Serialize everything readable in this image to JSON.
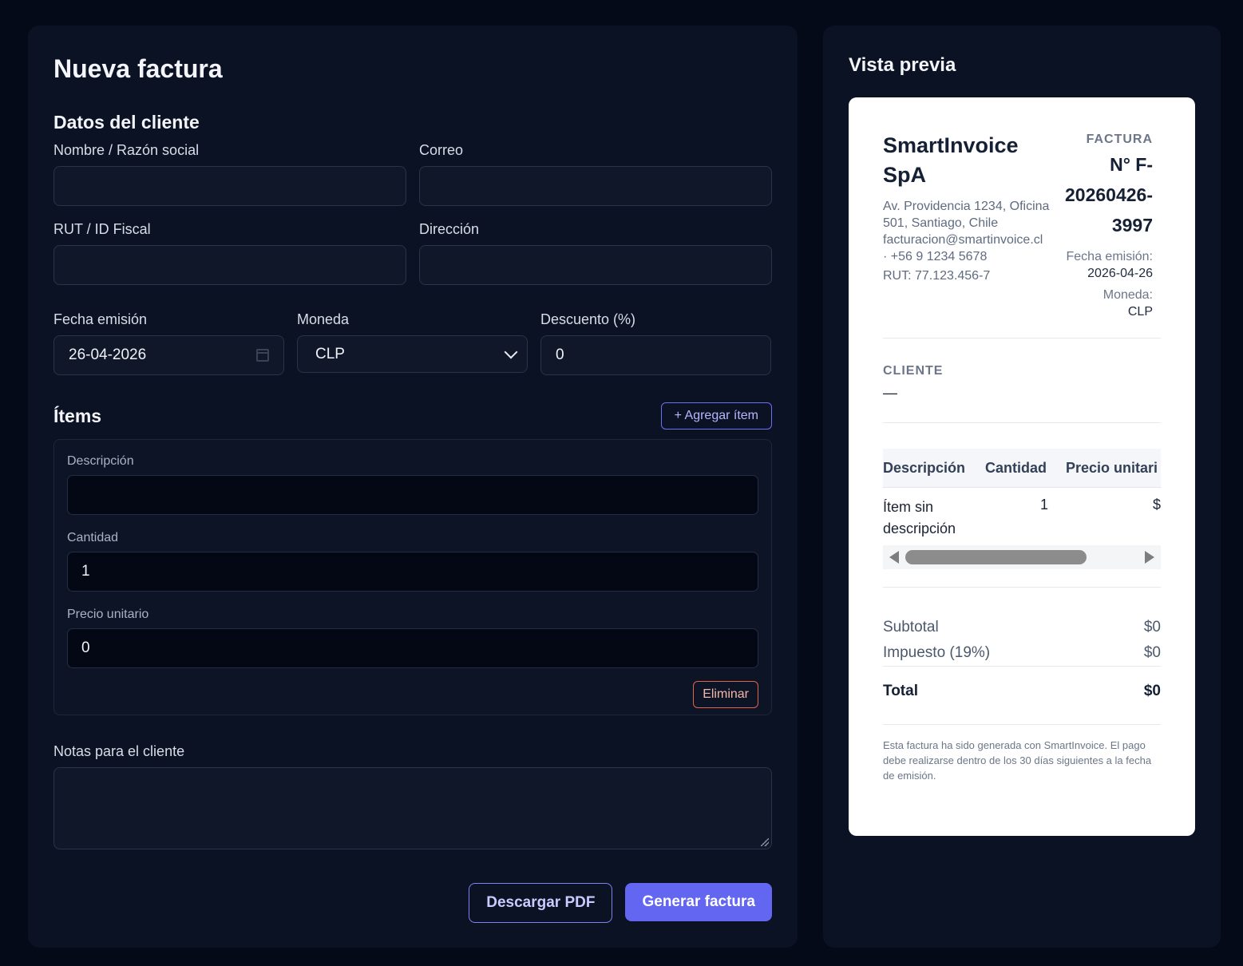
{
  "form": {
    "title": "Nueva factura",
    "client_section": "Datos del cliente",
    "fields": {
      "name_label": "Nombre / Razón social",
      "email_label": "Correo",
      "rut_label": "RUT / ID Fiscal",
      "address_label": "Dirección",
      "name_value": "",
      "email_value": "",
      "rut_value": "",
      "address_value": ""
    },
    "date_label": "Fecha emisión",
    "date_value": "26-04-2026",
    "currency_label": "Moneda",
    "currency_value": "CLP",
    "discount_label": "Descuento (%)",
    "discount_value": "0",
    "items_title": "Ítems",
    "add_item_label": "+ Agregar ítem",
    "item": {
      "description_label": "Descripción",
      "description_value": "",
      "quantity_label": "Cantidad",
      "quantity_value": "1",
      "price_label": "Precio unitario",
      "price_value": "0",
      "delete_label": "Eliminar"
    },
    "notes_label": "Notas para el cliente",
    "notes_value": "",
    "download_label": "Descargar PDF",
    "generate_label": "Generar factura"
  },
  "preview": {
    "title": "Vista previa",
    "company": {
      "name": "SmartInvoice SpA",
      "address": "Av. Providencia 1234, Oficina 501, Santiago, Chile",
      "contact": "facturacion@smartinvoice.cl · +56 9 1234 5678",
      "rut": "RUT: 77.123.456-7"
    },
    "invoice_label": "FACTURA",
    "invoice_number": "N° F-20260426-3997",
    "date_label": "Fecha emisión:",
    "date_value": "2026-04-26",
    "currency_label": "Moneda:",
    "currency_value": "CLP",
    "client_label": "CLIENTE",
    "client_value": "—",
    "table": {
      "headers": [
        "Descripción",
        "Cantidad",
        "Precio unitari"
      ],
      "rows": [
        {
          "description": "Ítem sin descripción",
          "quantity": "1",
          "price": "$"
        }
      ]
    },
    "subtotal_label": "Subtotal",
    "subtotal_value": "$0",
    "tax_label": "Impuesto (19%)",
    "tax_value": "$0",
    "total_label": "Total",
    "total_value": "$0",
    "footer": "Esta factura ha sido generada con SmartInvoice. El pago debe realizarse dentro de los 30 días siguientes a la fecha de emisión."
  },
  "colors": {
    "background": "#050a18",
    "panel": "#0b1223",
    "accent": "#6366f1",
    "danger": "#e0654a"
  }
}
